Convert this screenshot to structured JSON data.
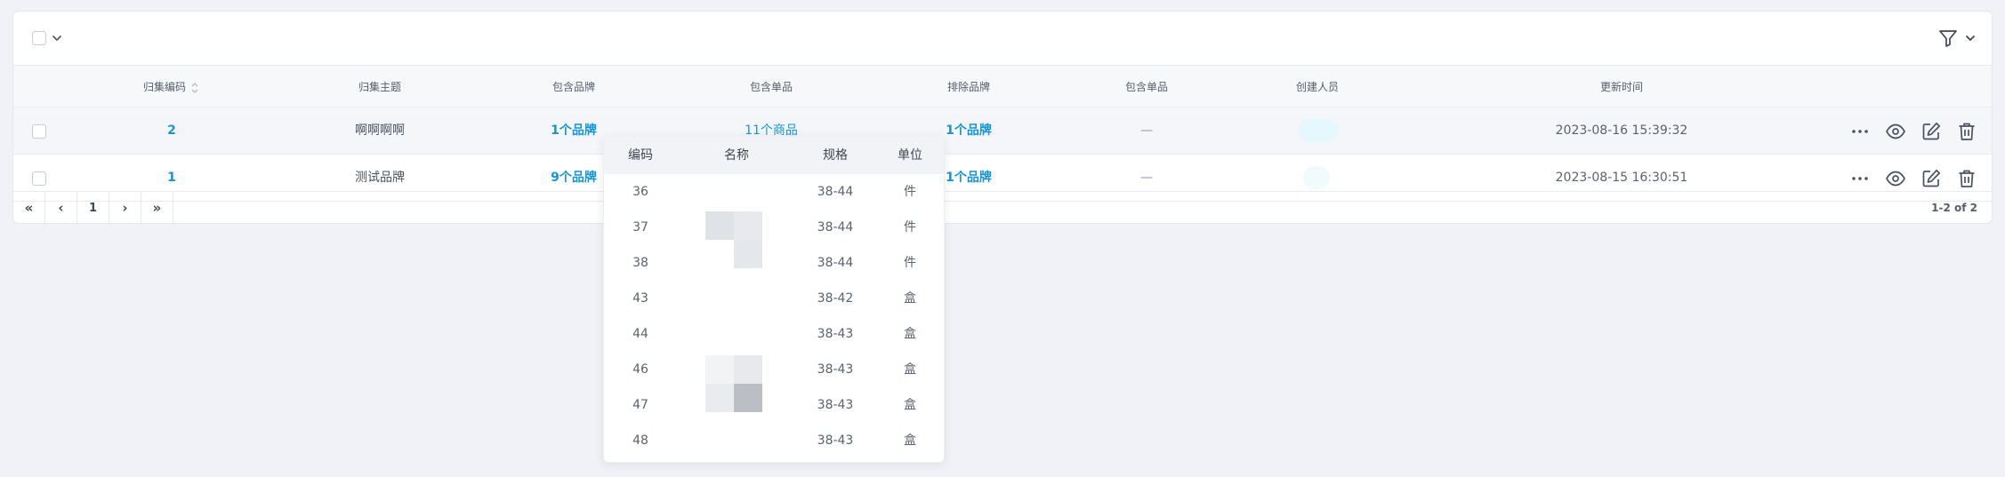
{
  "table": {
    "headers": {
      "code": "归集编码",
      "theme": "归集主题",
      "brands": "包含品牌",
      "items": "包含单品",
      "excluded_brands": "排除品牌",
      "excluded_items": "包含单品",
      "creator": "创建人员",
      "updated": "更新时间"
    },
    "rows": [
      {
        "code": "2",
        "theme": "啊啊啊啊",
        "brands": "1个品牌",
        "items": "11个商品",
        "excluded_brands": "1个品牌",
        "excluded_items": "—",
        "updated": "2023-08-16 15:39:32"
      },
      {
        "code": "1",
        "theme": "测试品牌",
        "brands": "9个品牌",
        "items": "",
        "excluded_brands": "1个品牌",
        "excluded_items": "—",
        "updated": "2023-08-15 16:30:51"
      }
    ]
  },
  "pagination": {
    "first": "«",
    "prev": "‹",
    "page": "1",
    "next": "›",
    "last": "»",
    "count": "1-2 of 2"
  },
  "popover": {
    "headers": {
      "code": "编码",
      "name": "名称",
      "spec": "规格",
      "unit": "单位"
    },
    "rows": [
      {
        "code": "36",
        "spec": "38-44",
        "unit": "件"
      },
      {
        "code": "37",
        "spec": "38-44",
        "unit": "件"
      },
      {
        "code": "38",
        "spec": "38-44",
        "unit": "件"
      },
      {
        "code": "43",
        "spec": "38-42",
        "unit": "盒"
      },
      {
        "code": "44",
        "spec": "38-43",
        "unit": "盒"
      },
      {
        "code": "46",
        "spec": "38-43",
        "unit": "盒"
      },
      {
        "code": "47",
        "spec": "38-43",
        "unit": "盒"
      },
      {
        "code": "48",
        "spec": "38-43",
        "unit": "盒"
      }
    ]
  },
  "icons": {
    "select_all_checkbox": "checkbox-icon",
    "select_dropdown": "chevron-down-icon",
    "filter": "filter-icon",
    "filter_dropdown": "chevron-down-icon",
    "sort": "sort-icon",
    "more": "more-icon",
    "view": "eye-icon",
    "edit": "edit-icon",
    "delete": "trash-icon"
  },
  "colors": {
    "link": "#1595d8",
    "background": "#f0f2f7",
    "header_bg": "#f7f8fa",
    "creator_tag": "#e6f9fe"
  }
}
